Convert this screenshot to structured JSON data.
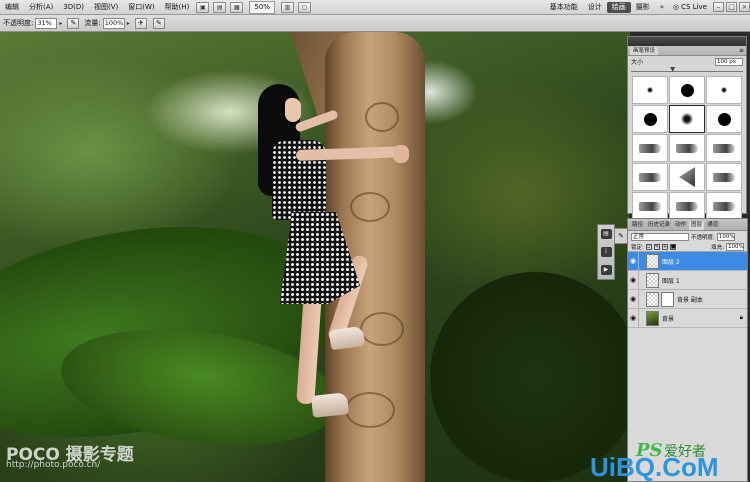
{
  "menubar": {
    "items": [
      "编辑",
      "分析(A)",
      "3D(D)",
      "视图(V)",
      "窗口(W)",
      "帮助(H)"
    ],
    "zoom": "50%",
    "workspaces": [
      "基本功能",
      "设计",
      "绘画",
      "摄影"
    ],
    "active_workspace": "绘画",
    "cs_live": "CS Live",
    "window_controls": [
      "–",
      "□",
      "×"
    ]
  },
  "options": {
    "opacity_label": "不透明度:",
    "opacity_value": "31%",
    "flow_label": "流量:",
    "flow_value": "100%"
  },
  "brush_panel": {
    "tabs": [
      "画笔预设"
    ],
    "size_label": "大小",
    "size_value": "100 px",
    "slider_fraction": 0.35
  },
  "layers_panel": {
    "tabs": [
      "路径",
      "历史记录",
      "动作",
      "图层",
      "通道"
    ],
    "active_tab": "图层",
    "blend_mode": "正常",
    "opacity_label": "不透明度:",
    "opacity_value": "100%",
    "lock_label": "锁定:",
    "fill_label": "填充:",
    "fill_value": "100%",
    "layers": [
      {
        "name": "图层 2",
        "selected": true,
        "thumb": "transparent"
      },
      {
        "name": "图层 1",
        "selected": false,
        "thumb": "transparent"
      },
      {
        "name": "背景 副本",
        "selected": false,
        "thumb": "transparent-mask"
      },
      {
        "name": "背景",
        "selected": false,
        "thumb": "photo",
        "locked": true
      }
    ]
  },
  "watermarks": {
    "poco": "POCO 摄影专题",
    "poco_url": "http://photo.poco.cn/",
    "ps_logo": "PS",
    "ps_logo_cn": "爱好者",
    "uibq": "UiBQ.CoM"
  },
  "colors": {
    "selected_layer": "#3d8ae6",
    "uibq_blue": "#2b95e0",
    "ps_green": "#3fb84a"
  }
}
